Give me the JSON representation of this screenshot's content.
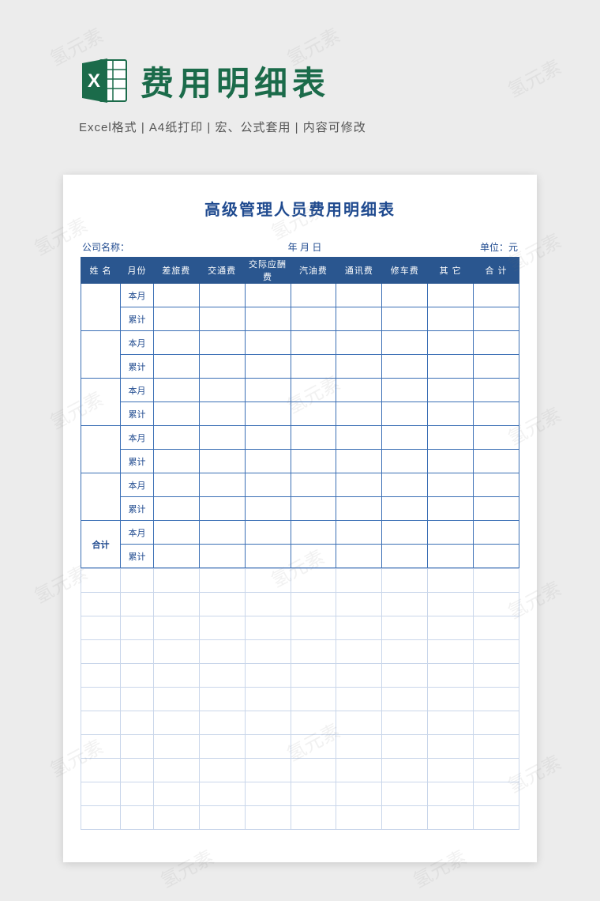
{
  "header": {
    "title": "费用明细表",
    "subtitle": "Excel格式 |  A4纸打印 |  宏、公式套用 |  内容可修改"
  },
  "sheet": {
    "doc_title": "高级管理人员费用明细表",
    "meta": {
      "company": "公司名称：",
      "date": "年  月  日",
      "unit": "单位：元"
    },
    "columns": [
      "姓 名",
      "月份",
      "差旅费",
      "交通费",
      "交际应酬费",
      "汽油费",
      "通讯费",
      "修车费",
      "其 它",
      "合 计"
    ],
    "row_labels": {
      "this_month": "本月",
      "cumulative": "累计",
      "total": "合计"
    }
  },
  "watermark": "氢元素"
}
